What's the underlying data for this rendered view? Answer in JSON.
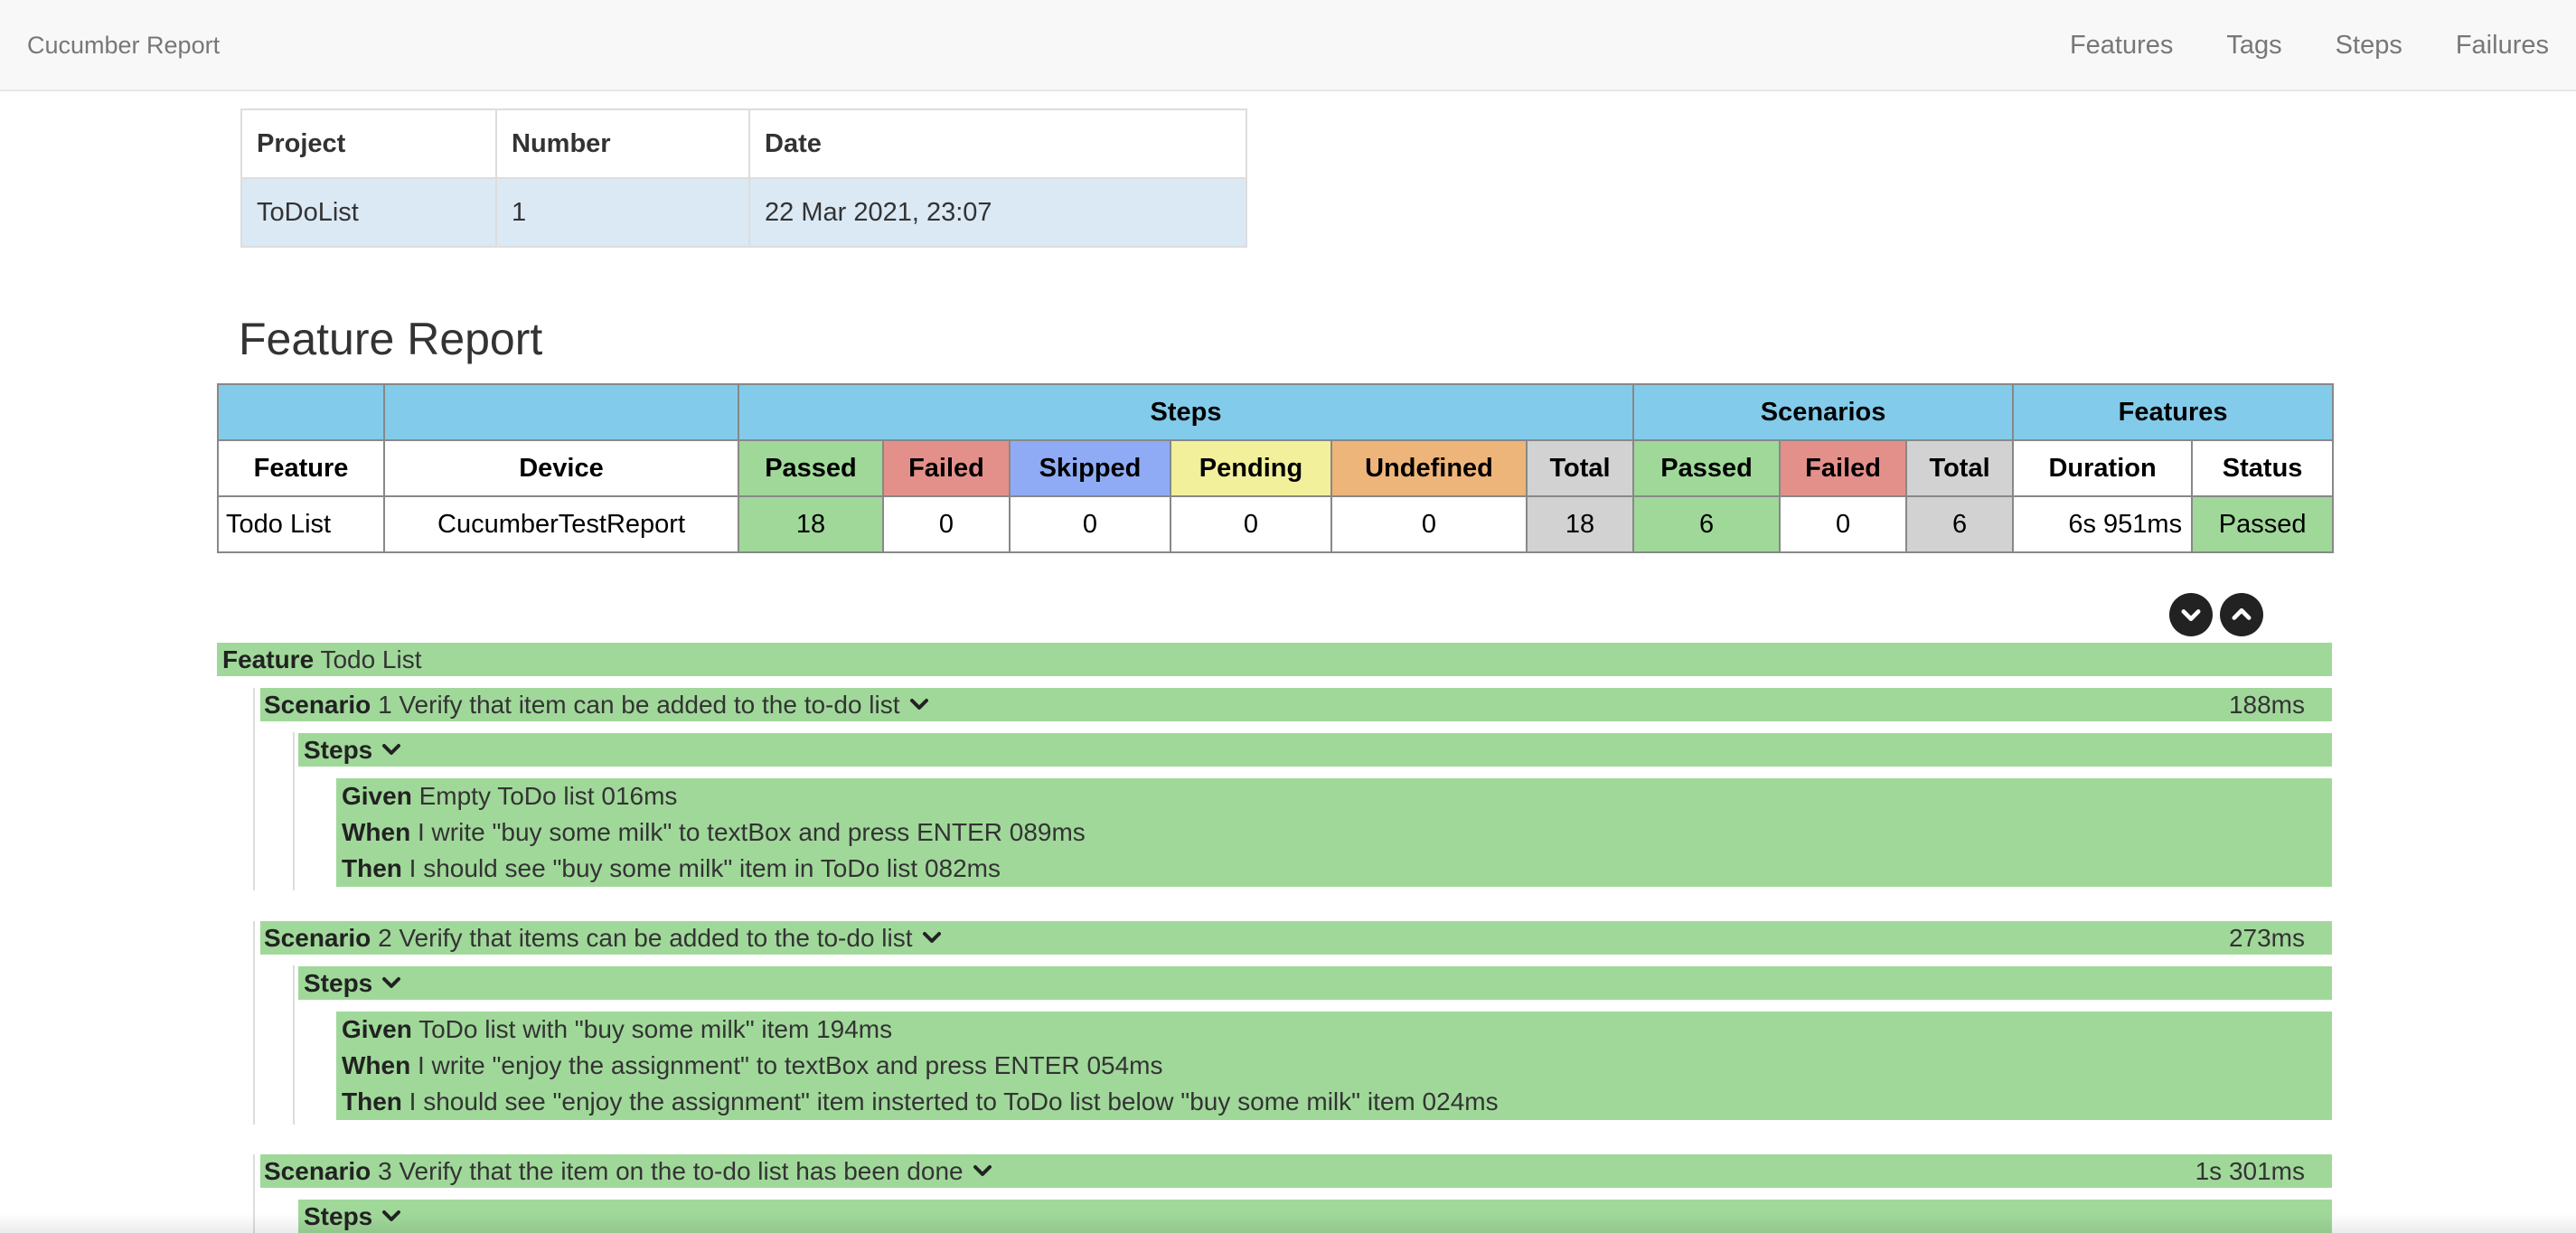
{
  "navbar": {
    "brand": "Cucumber Report",
    "links": [
      "Features",
      "Tags",
      "Steps",
      "Failures"
    ]
  },
  "info_table": {
    "headers": [
      "Project",
      "Number",
      "Date"
    ],
    "row": [
      "ToDoList",
      "1",
      "22 Mar 2021, 23:07"
    ]
  },
  "report_title": "Feature Report",
  "stats_table": {
    "groups": [
      "Steps",
      "Scenarios",
      "Features"
    ],
    "headers": [
      "Feature",
      "Device",
      "Passed",
      "Failed",
      "Skipped",
      "Pending",
      "Undefined",
      "Total",
      "Passed",
      "Failed",
      "Total",
      "Duration",
      "Status"
    ],
    "row": [
      "Todo List",
      "CucumberTestReport",
      "18",
      "0",
      "0",
      "0",
      "0",
      "18",
      "6",
      "0",
      "6",
      "6s 951ms",
      "Passed"
    ]
  },
  "icons": {
    "expand_all": "chevron-down-circle-icon",
    "collapse_all": "chevron-up-circle-icon",
    "toggle": "chevron-down-icon"
  },
  "colors": {
    "passed": "#a0d89a",
    "failed": "#e4908a",
    "skipped": "#8fabf5",
    "pending": "#f2f09a",
    "undefined": "#eeb57a",
    "total": "#d2d2d2",
    "group_header": "#83cbea"
  },
  "feature": {
    "keyword": "Feature",
    "name": "Todo List",
    "steps_label": "Steps",
    "scenario_keyword": "Scenario",
    "scenarios": [
      {
        "name": "1 Verify that item can be added to the to-do list",
        "duration": "188ms",
        "steps": [
          {
            "keyword": "Given",
            "text": "Empty ToDo list",
            "duration": "016ms"
          },
          {
            "keyword": "When",
            "text": "I write \"buy some milk\" to textBox and press ENTER",
            "duration": "089ms"
          },
          {
            "keyword": "Then",
            "text": "I should see \"buy some milk\" item in ToDo list",
            "duration": "082ms"
          }
        ]
      },
      {
        "name": "2 Verify that items can be added to the to-do list",
        "duration": "273ms",
        "steps": [
          {
            "keyword": "Given",
            "text": "ToDo list with \"buy some milk\" item",
            "duration": "194ms"
          },
          {
            "keyword": "When",
            "text": "I write \"enjoy the assignment\" to textBox and press ENTER",
            "duration": "054ms"
          },
          {
            "keyword": "Then",
            "text": "I should see \"enjoy the assignment\" item insterted to ToDo list below \"buy some milk\" item",
            "duration": "024ms"
          }
        ]
      },
      {
        "name": "3 Verify that the item on the to-do list has been done",
        "duration": "1s 301ms",
        "steps": []
      }
    ]
  }
}
